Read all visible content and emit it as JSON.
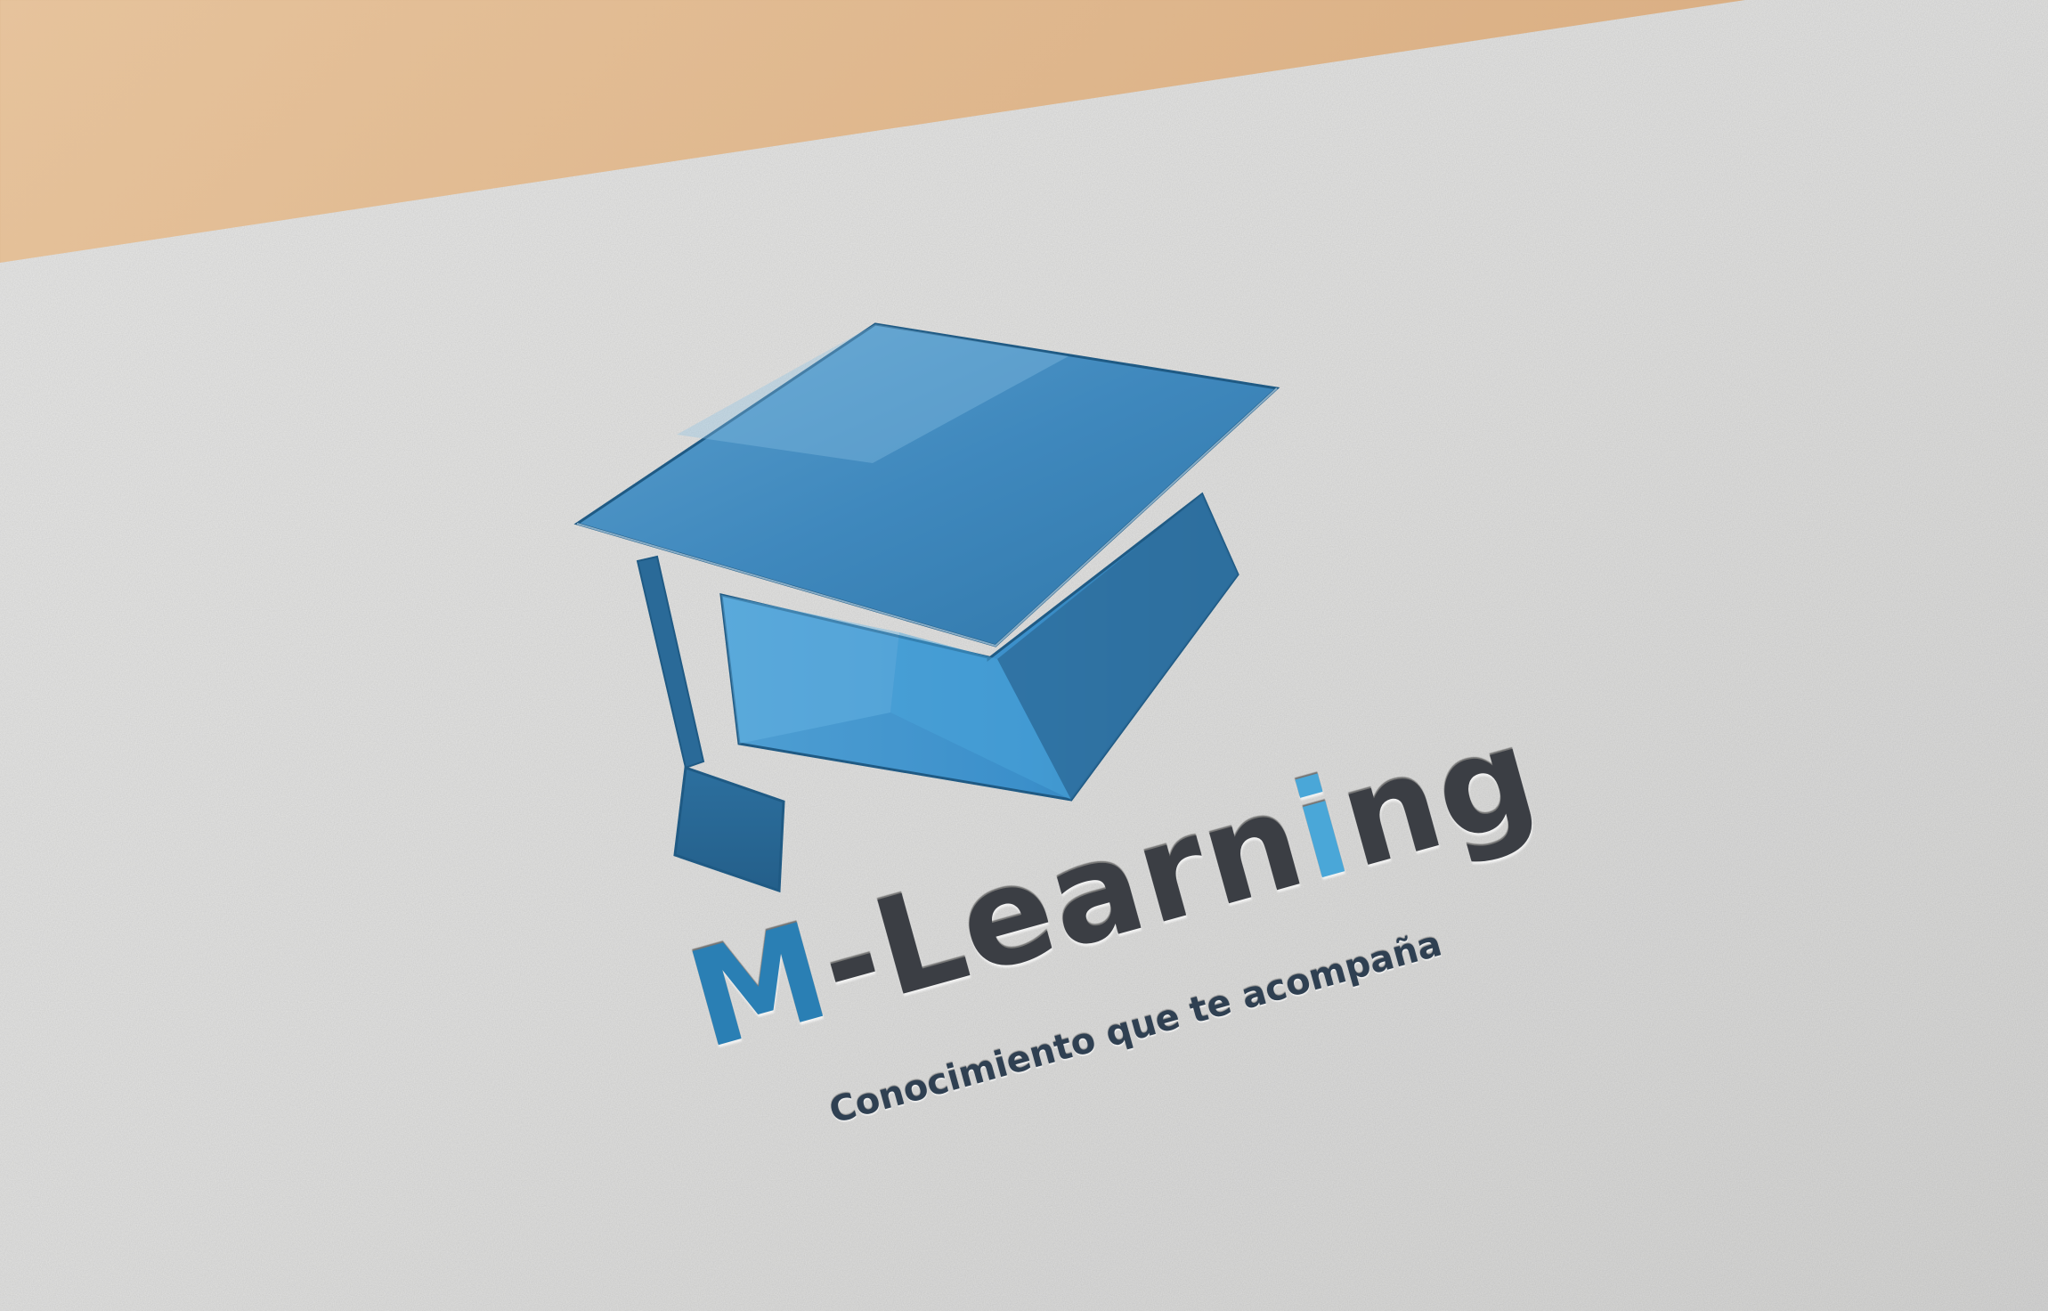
{
  "logo": {
    "name_prefix": "M",
    "name_middle": "-Lear",
    "name_n": "n",
    "name_i": "i",
    "name_ng": "ng",
    "tagline": "Conocimiento que te acompaña"
  },
  "colors": {
    "background": "#d9ad82",
    "paper": "#e4e4e2",
    "cap_dark": "#2e6f9c",
    "cap_mid": "#3f8fc4",
    "cap_light": "#6bb5e0",
    "text_dark": "#3b3e44",
    "text_accent": "#2a7fb4"
  },
  "icons": {
    "emblem": "graduation-cap-icon"
  }
}
